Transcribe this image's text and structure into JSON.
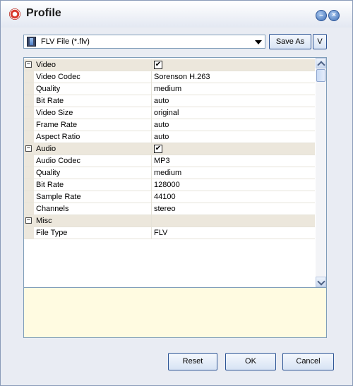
{
  "window": {
    "title": "Profile"
  },
  "titlebar_buttons": {
    "minimize_icon": "minimize-circle-icon",
    "close_icon": "close-circle-icon"
  },
  "format": {
    "selected": "FLV File (*.flv)",
    "icon": "film-icon"
  },
  "toolbar": {
    "save_as": "Save As",
    "v": "V"
  },
  "properties": [
    {
      "kind": "category",
      "label": "Video",
      "checked": true
    },
    {
      "kind": "prop",
      "label": "Video Codec",
      "value": "Sorenson H.263"
    },
    {
      "kind": "prop",
      "label": "Quality",
      "value": "medium"
    },
    {
      "kind": "prop",
      "label": "Bit Rate",
      "value": "auto"
    },
    {
      "kind": "prop",
      "label": "Video Size",
      "value": "original"
    },
    {
      "kind": "prop",
      "label": "Frame Rate",
      "value": "auto"
    },
    {
      "kind": "prop",
      "label": "Aspect Ratio",
      "value": "auto"
    },
    {
      "kind": "category",
      "label": "Audio",
      "checked": true
    },
    {
      "kind": "prop",
      "label": "Audio Codec",
      "value": "MP3"
    },
    {
      "kind": "prop",
      "label": "Quality",
      "value": "medium"
    },
    {
      "kind": "prop",
      "label": "Bit Rate",
      "value": "128000"
    },
    {
      "kind": "prop",
      "label": "Sample Rate",
      "value": "44100"
    },
    {
      "kind": "prop",
      "label": "Channels",
      "value": "stereo"
    },
    {
      "kind": "category",
      "label": "Misc",
      "checked": null
    },
    {
      "kind": "prop",
      "label": "File Type",
      "value": "FLV"
    }
  ],
  "buttons": {
    "reset": "Reset",
    "ok": "OK",
    "cancel": "Cancel"
  },
  "colors": {
    "category_bg": "#ece7dc",
    "description_bg": "#fffbe1",
    "button_border": "#2c5494"
  }
}
